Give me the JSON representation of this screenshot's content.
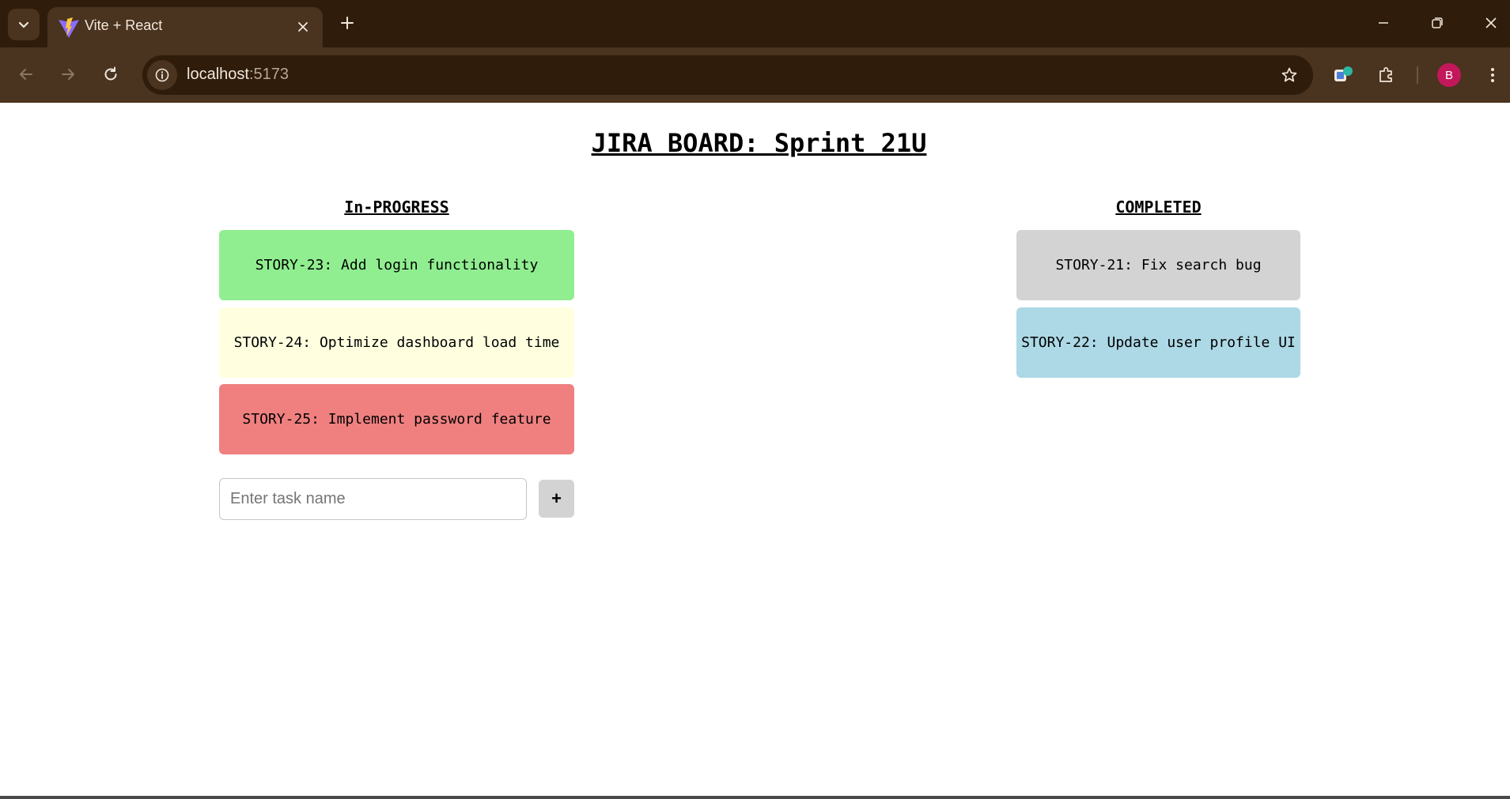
{
  "browser": {
    "tab": {
      "title": "Vite + React",
      "favicon": "vite-logo"
    },
    "url_host": "localhost",
    "url_port": ":5173",
    "profile_initial": "B",
    "colors": {
      "frame": "#2f1c0b",
      "toolbar": "#4a331f",
      "avatar": "#c2185b"
    }
  },
  "board": {
    "title": "JIRA BOARD: Sprint 21U",
    "columns": [
      {
        "heading": "In-PROGRESS",
        "cards": [
          {
            "label": "STORY-23: Add login functionality",
            "color": "#90ee90"
          },
          {
            "label": "STORY-24: Optimize dashboard load time",
            "color": "#ffffe0"
          },
          {
            "label": "STORY-25: Implement password feature",
            "color": "#f08080"
          }
        ]
      },
      {
        "heading": "COMPLETED",
        "cards": [
          {
            "label": "STORY-21: Fix search bug",
            "color": "#d3d3d3"
          },
          {
            "label": "STORY-22: Update user profile UI",
            "color": "#add8e6"
          }
        ]
      }
    ],
    "new_task": {
      "placeholder": "Enter task name",
      "value": "",
      "add_label": "+"
    }
  }
}
